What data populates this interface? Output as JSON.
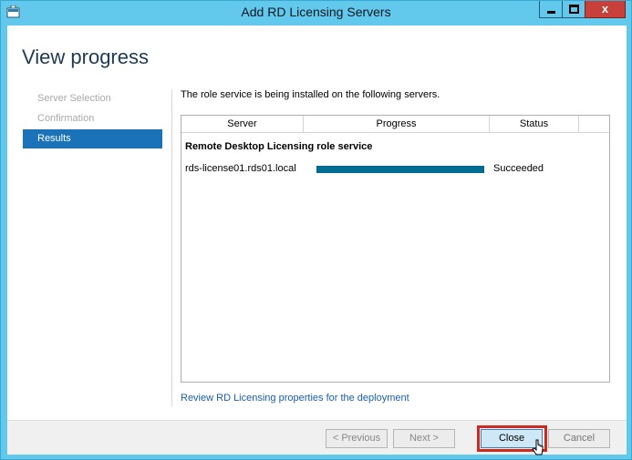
{
  "window": {
    "title": "Add RD Licensing Servers",
    "controls": {
      "minimize_icon": "minimize-icon",
      "maximize_icon": "maximize-icon",
      "close_icon": "close-icon",
      "close_glyph": "x"
    }
  },
  "page": {
    "title": "View progress"
  },
  "nav": {
    "items": [
      {
        "label": "Server Selection",
        "active": false
      },
      {
        "label": "Confirmation",
        "active": false
      },
      {
        "label": "Results",
        "active": true
      }
    ]
  },
  "main": {
    "intro": "The role service is being installed on the following servers.",
    "table": {
      "columns": [
        "Server",
        "Progress",
        "Status",
        ""
      ],
      "group": "Remote Desktop Licensing role service",
      "rows": [
        {
          "server": "rds-license01.rds01.local",
          "progress_fraction": 1.0,
          "status": "Succeeded"
        }
      ]
    },
    "review_link": "Review RD Licensing properties for the deployment"
  },
  "footer": {
    "previous": "< Previous",
    "next": "Next >",
    "close": "Close",
    "cancel": "Cancel"
  },
  "colors": {
    "titlebar": "#62c8ec",
    "nav_active": "#1a73b8",
    "progress_fill": "#006c92",
    "highlight": "#cc2a1f",
    "link": "#1a5fa8"
  }
}
